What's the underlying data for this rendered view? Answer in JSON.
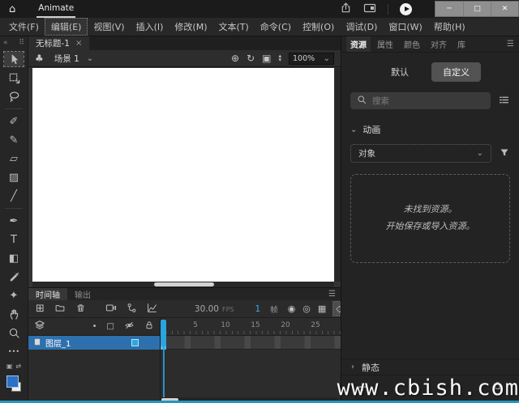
{
  "titlebar": {
    "app_tab": "Animate"
  },
  "menubar": {
    "items": [
      "文件(F)",
      "编辑(E)",
      "视图(V)",
      "插入(I)",
      "修改(M)",
      "文本(T)",
      "命令(C)",
      "控制(O)",
      "调试(D)",
      "窗口(W)",
      "帮助(H)"
    ]
  },
  "document": {
    "tab_title": "无标题-1",
    "scene_label": "场景 1",
    "zoom_level": "100%"
  },
  "timeline": {
    "tabs": [
      "时间轴",
      "输出"
    ],
    "fps_value": "30.00",
    "fps_unit": "FPS",
    "frame_value": "1",
    "frame_unit": "帧",
    "ruler_ticks": [
      "5",
      "10",
      "15",
      "20",
      "25"
    ],
    "layer_name": "图层_1"
  },
  "right_panel": {
    "tabs": [
      "资源",
      "属性",
      "颜色",
      "对齐",
      "库"
    ],
    "toggle_default": "默认",
    "toggle_custom": "自定义",
    "search_placeholder": "搜索",
    "animation_section": "动画",
    "object_dropdown": "对象",
    "empty_line1": "未找到资源。",
    "empty_line2": "开始保存或导入资源。",
    "static_section": "静态"
  },
  "watermark": "www.cbish.com",
  "colors": {
    "accent_blue": "#3fa9f5",
    "playhead_blue": "#2aa3e0",
    "selected_layer_blue": "#2d70ad",
    "fill_swatch_blue": "#2b71c4",
    "watermark_line": "#2596be"
  },
  "icons": {
    "home": "⌂",
    "club": "♣",
    "chevron_down": "⌄",
    "chevron_right": "›",
    "chevron_up_small": "▴",
    "chevron_down_small": "▾",
    "tab_close": "×",
    "collapse_left": "«",
    "drag_dots": "⠿",
    "minimize": "─",
    "maximize": "□",
    "window_close": "✕",
    "crosshair": "⊕",
    "rotate": "↻",
    "center_frame": "▣",
    "new_layer": "⊞",
    "onion_skin": "◉",
    "onion_outline": "◎",
    "edit_multiple_frames": "▦",
    "auto_keyframe": "◇",
    "remove_keyframe": "⊖",
    "dot_column": "•",
    "outline_column": "□",
    "panel_menu": "☰",
    "more_tools": "•••",
    "plus": "+",
    "swap_colors": "⇄",
    "default_colors": "▣",
    "brush_fluid": "✐",
    "brush_classic": "✎",
    "eraser": "▱",
    "rect_tool": "▨",
    "line_tool": "╱",
    "pen_tool": "✒",
    "text_tool": "T",
    "paint_bucket": "◧",
    "asset_warp": "✦"
  }
}
